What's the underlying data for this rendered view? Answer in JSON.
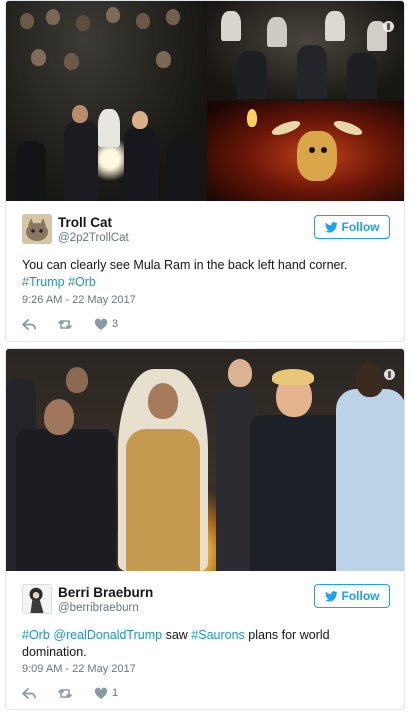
{
  "tweets": [
    {
      "user_name": "Troll Cat",
      "handle": "@2p2TrollCat",
      "follow_label": "Follow",
      "text_plain": "You can clearly see Mula Ram in the back left hand corner.",
      "hashtags": [
        "#Trump",
        "#Orb"
      ],
      "timestamp": "9:26 AM - 22 May 2017",
      "likes": "3",
      "avatar_icon": "cat-avatar-icon"
    },
    {
      "user_name": "Berri Braeburn",
      "handle": "@berribraeburn",
      "follow_label": "Follow",
      "text_parts": {
        "tag1": "#Orb",
        "mention": "@realDonaldTrump",
        "mid": "saw",
        "tag2": "#Saurons",
        "rest": "plans for world domination."
      },
      "timestamp": "9:09 AM - 22 May 2017",
      "likes": "1",
      "avatar_icon": "character-avatar-icon"
    }
  ],
  "colors": {
    "link": "#1b95e0",
    "follow": "#1da1f2",
    "meta": "#657786",
    "border": "#e1e8ed"
  }
}
